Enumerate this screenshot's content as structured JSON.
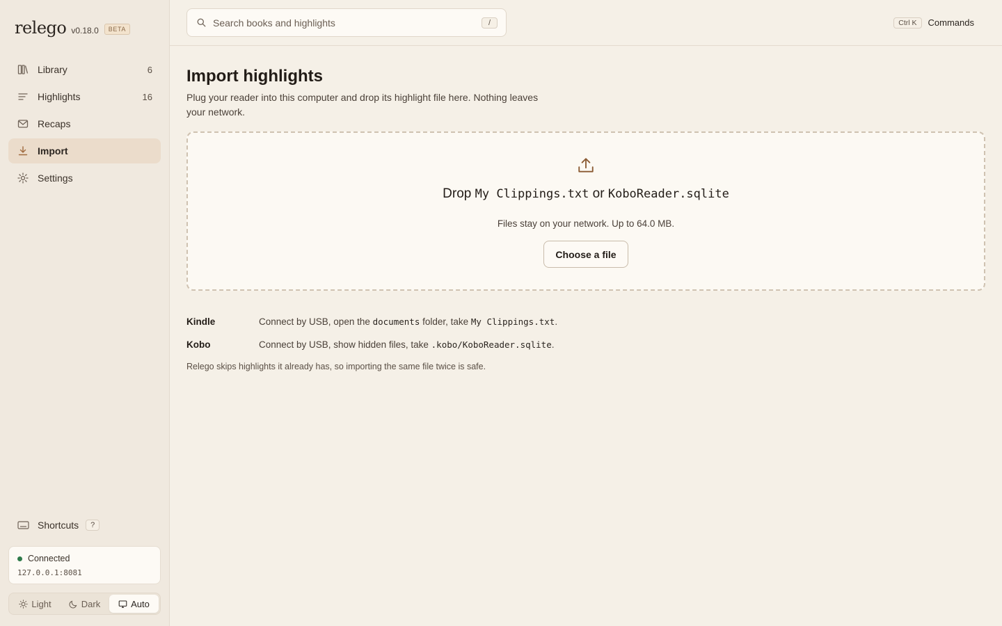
{
  "brand": {
    "name": "relego",
    "version": "v0.18.0",
    "badge": "BETA"
  },
  "sidebar": {
    "items": [
      {
        "label": "Library",
        "count": "6",
        "icon": "library-icon"
      },
      {
        "label": "Highlights",
        "count": "16",
        "icon": "highlights-icon"
      },
      {
        "label": "Recaps",
        "count": "",
        "icon": "mail-icon"
      },
      {
        "label": "Import",
        "count": "",
        "icon": "download-icon",
        "active": true
      },
      {
        "label": "Settings",
        "count": "",
        "icon": "gear-icon"
      }
    ],
    "shortcuts": {
      "label": "Shortcuts",
      "key": "?"
    },
    "status": {
      "label": "Connected",
      "address": "127.0.0.1:8081",
      "color": "#2f7a4a"
    },
    "theme": {
      "light": "Light",
      "dark": "Dark",
      "auto": "Auto",
      "selected": "Auto"
    }
  },
  "topbar": {
    "search_placeholder": "Search books and highlights",
    "search_key": "/",
    "commands_key": "Ctrl K",
    "commands_label": "Commands"
  },
  "main": {
    "title": "Import highlights",
    "subtitle": "Plug your reader into this computer and drop its highlight file here. Nothing leaves your network.",
    "drop": {
      "prefix": "Drop",
      "file1": "My Clippings.txt",
      "or": "or",
      "file2": "KoboReader.sqlite",
      "note": "Files stay on your network. Up to 64.0 MB.",
      "button": "Choose a file"
    },
    "devices": [
      {
        "name": "Kindle",
        "pre": "Connect by USB, open the ",
        "code1": "documents",
        "mid": " folder, take ",
        "code2": "My Clippings.txt",
        "post": "."
      },
      {
        "name": "Kobo",
        "pre": "Connect by USB, show hidden files, take ",
        "code1": ".kobo/KoboReader.sqlite",
        "post": "."
      }
    ],
    "footnote": "Relego skips highlights it already has, so importing the same file twice is safe."
  },
  "colors": {
    "accent": "#a06a3e",
    "background": "#f5f0e7",
    "sidebar": "#f0e9df"
  }
}
